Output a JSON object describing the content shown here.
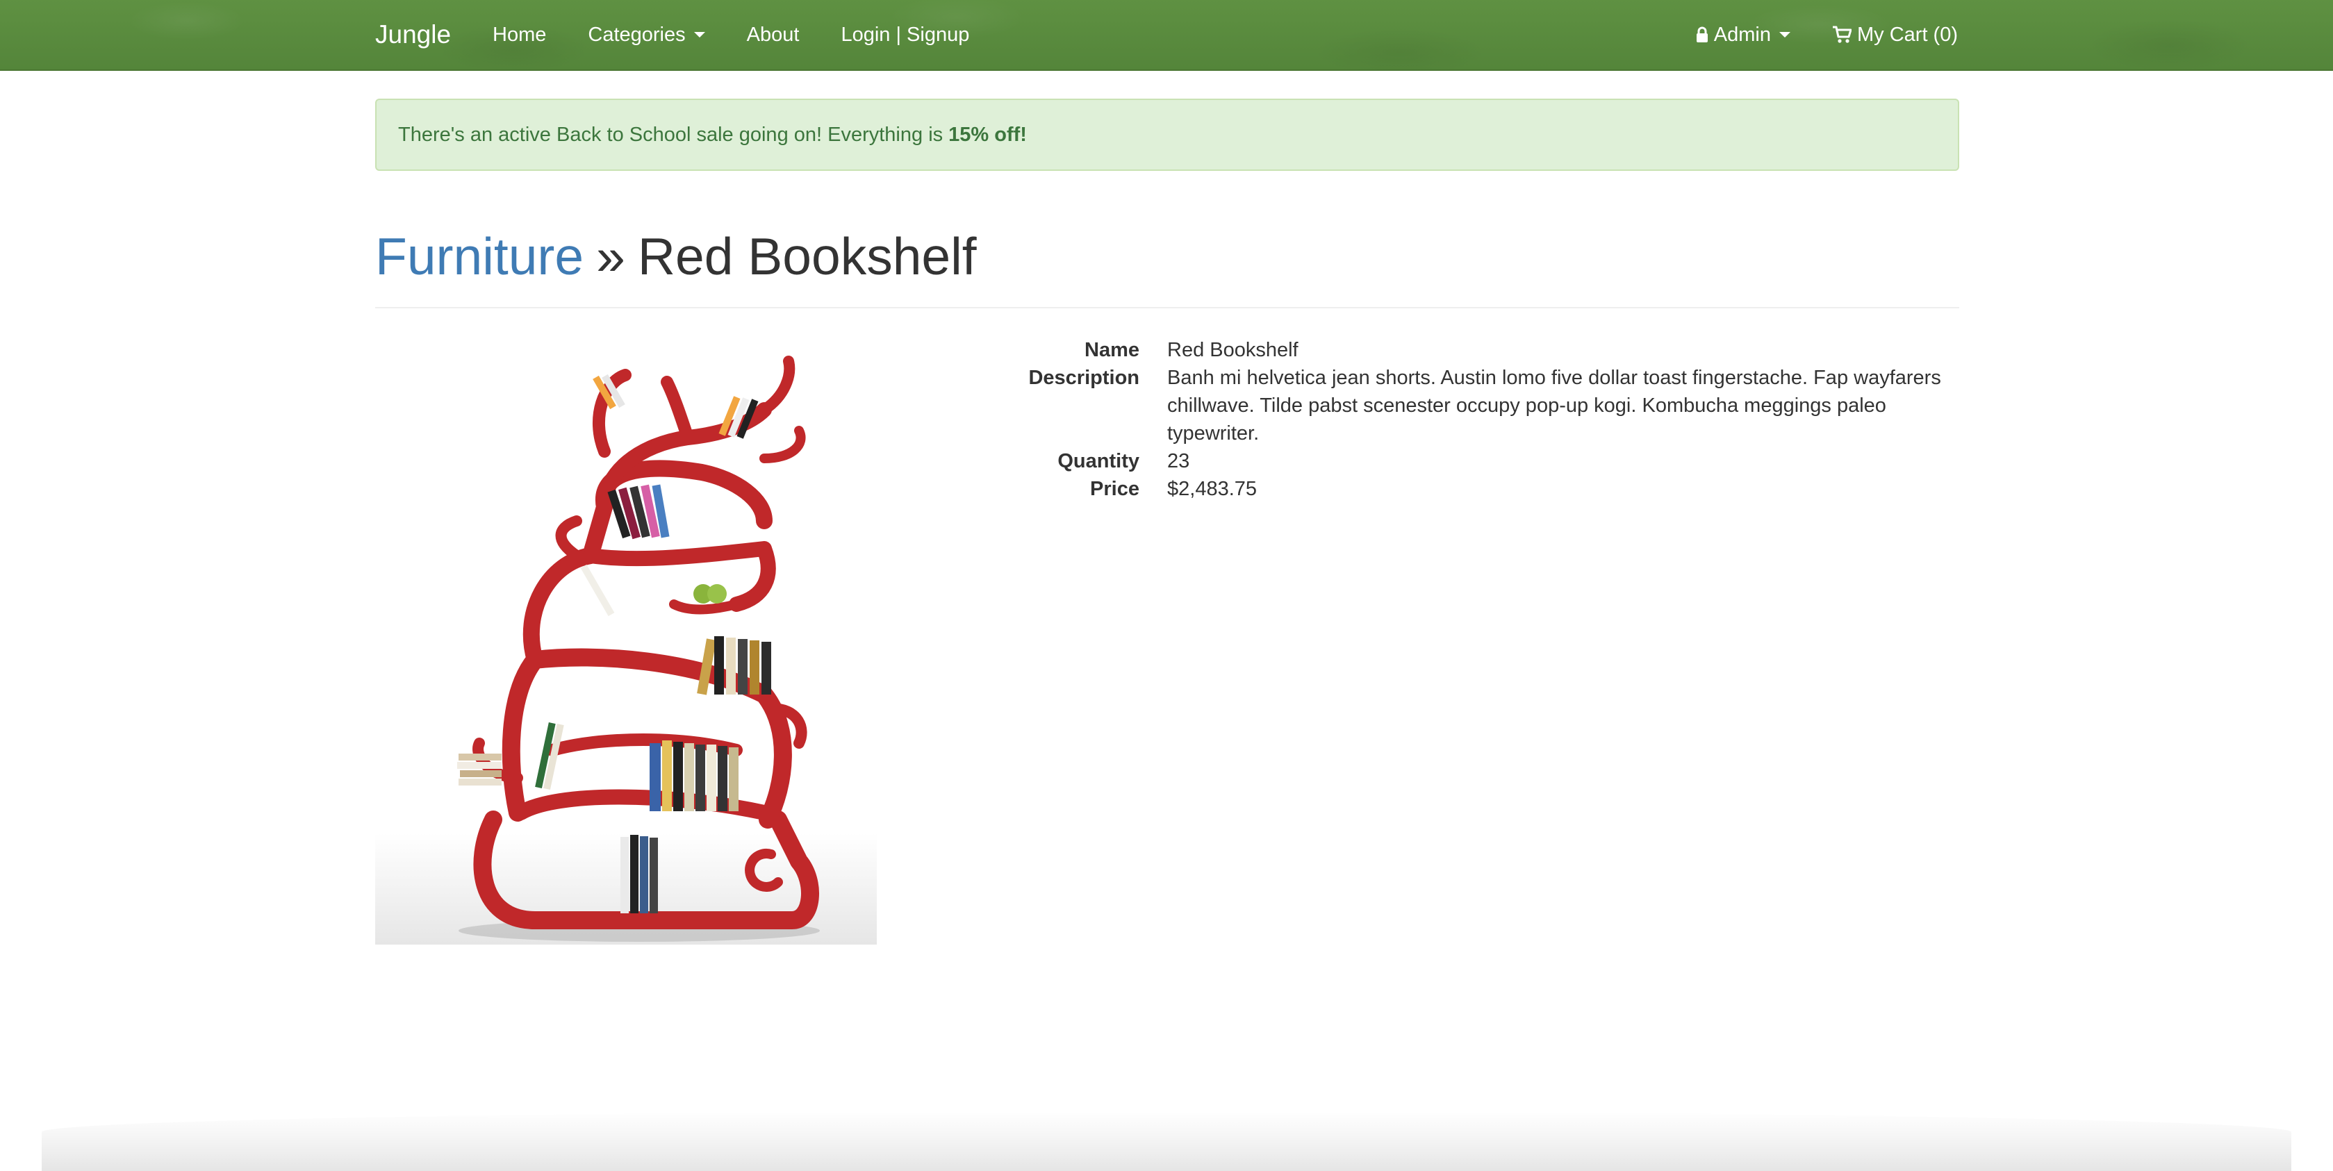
{
  "navbar": {
    "brand": "Jungle",
    "home": "Home",
    "categories": "Categories",
    "about": "About",
    "login_signup": "Login | Signup",
    "admin": "Admin",
    "cart": "My Cart (0)"
  },
  "alert": {
    "message": "There's an active Back to School sale going on! Everything is",
    "emphasis": "15% off!"
  },
  "heading": {
    "category": "Furniture",
    "separator": "»",
    "product": "Red Bookshelf"
  },
  "details": {
    "name_label": "Name",
    "name_value": "Red Bookshelf",
    "description_label": "Description",
    "description_value": "Banh mi helvetica jean shorts. Austin lomo five dollar toast fingerstache. Fap wayfarers chillwave. Tilde pabst scenester occupy pop-up kogi. Kombucha meggings paleo typewriter.",
    "quantity_label": "Quantity",
    "quantity_value": "23",
    "price_label": "Price",
    "price_value": "$2,483.75"
  },
  "colors": {
    "navbar": "#5a8a3c",
    "alert_bg": "#dff0d8",
    "alert_text": "#3c763d",
    "link": "#3f7bb4",
    "bookshelf_red": "#c0282a"
  },
  "icons": {
    "admin": "lock-icon",
    "cart": "shopping-cart-icon"
  }
}
